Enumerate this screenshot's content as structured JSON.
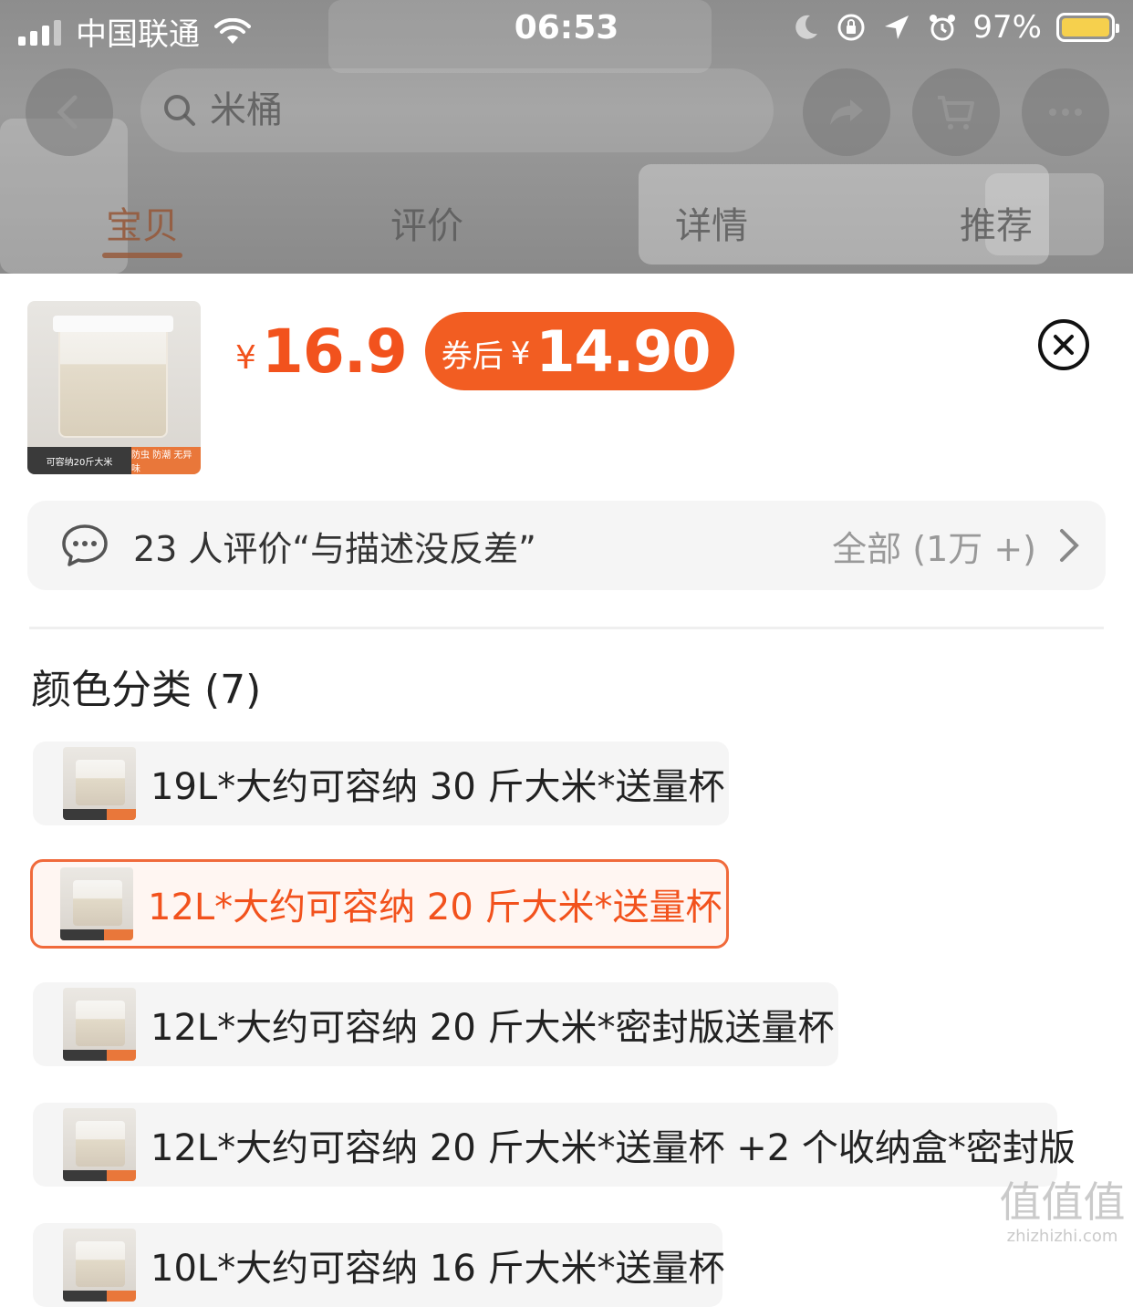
{
  "status_bar": {
    "carrier": "中国联通",
    "time": "06:53",
    "battery": "97%"
  },
  "search": {
    "placeholder": "米桶"
  },
  "tabs": [
    {
      "label": "宝贝",
      "active": true
    },
    {
      "label": "评价",
      "active": false
    },
    {
      "label": "详情",
      "active": false
    },
    {
      "label": "推荐",
      "active": false
    }
  ],
  "product": {
    "thumb_caption_left": "可容纳20斤大米",
    "thumb_caption_right": "防虫 防潮 无异味",
    "currency": "¥",
    "price": "16.9",
    "coupon_label": "券后",
    "coupon_currency": "¥",
    "coupon_price": "14.90"
  },
  "review": {
    "text": "23 人评价“与描述没反差”",
    "all_label": "全部 (1万 +)"
  },
  "section": {
    "title": "颜色分类 (7)"
  },
  "options": [
    {
      "label": "19L*大约可容纳 30 斤大米*送量杯",
      "selected": false
    },
    {
      "label": "12L*大约可容纳 20 斤大米*送量杯",
      "selected": true
    },
    {
      "label": "12L*大约可容纳 20 斤大米*密封版送量杯",
      "selected": false
    },
    {
      "label": "12L*大约可容纳 20 斤大米*送量杯 +2 个收纳盒*密封版",
      "selected": false
    },
    {
      "label": "10L*大约可容纳 16 斤大米*送量杯",
      "selected": false
    }
  ],
  "watermark": {
    "main": "值值值",
    "sub": "zhizhizhi.com"
  },
  "colors": {
    "accent": "#f2521d",
    "coupon_bg": "#f25d22",
    "selected_border": "#f06a3b",
    "option_bg": "#f5f5f5"
  }
}
